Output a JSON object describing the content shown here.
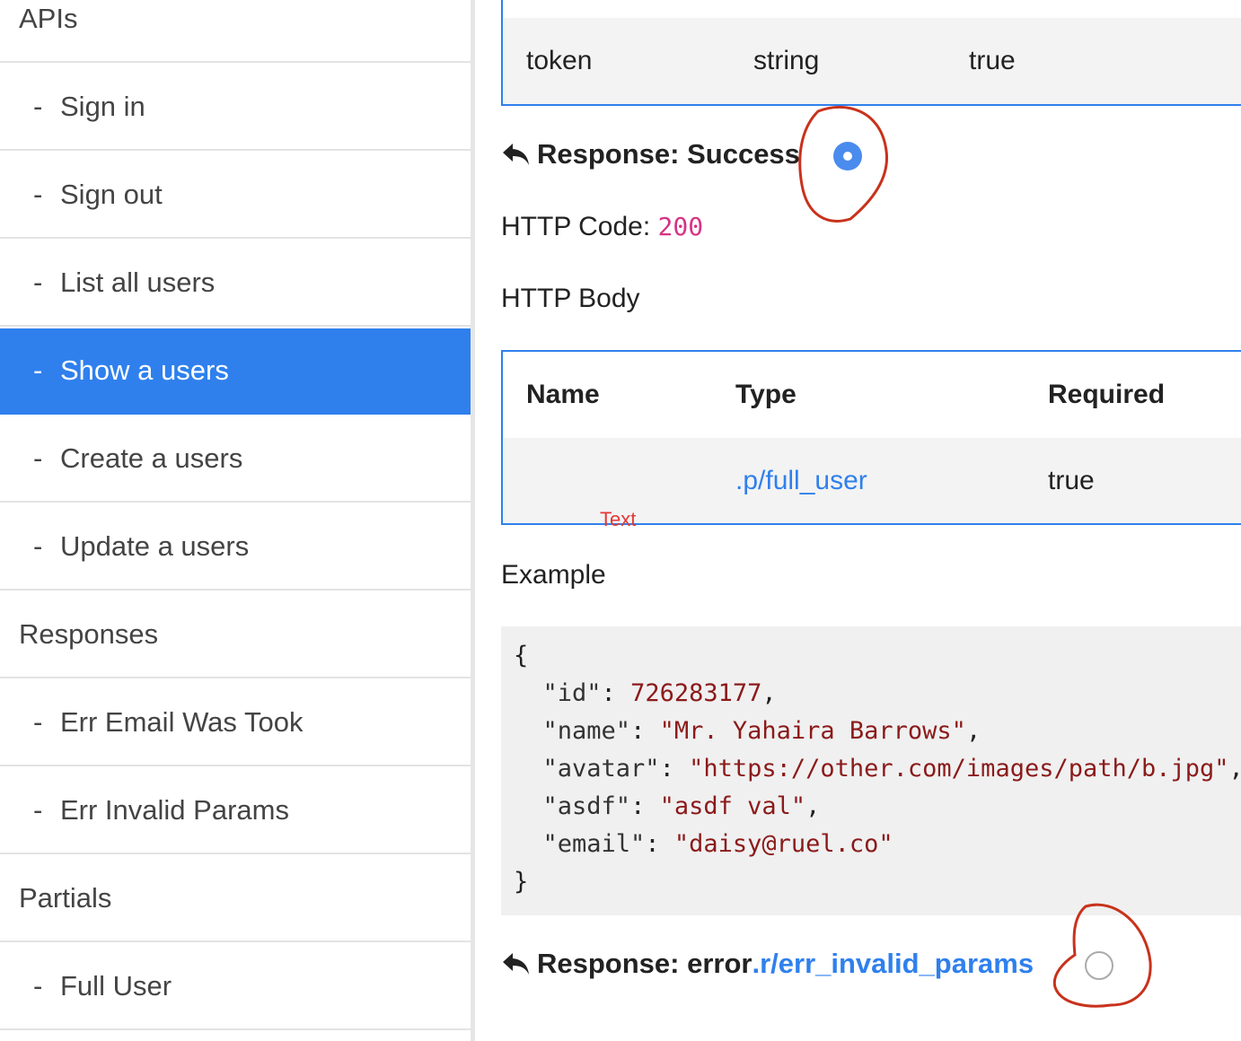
{
  "sidebar": {
    "sections": [
      {
        "label": "APIs",
        "items": [
          "Sign in",
          "Sign out",
          "List all users",
          "Show a users",
          "Create a users",
          "Update a users"
        ]
      },
      {
        "label": "Responses",
        "items": [
          "Err Email Was Took",
          "Err Invalid Params"
        ]
      },
      {
        "label": "Partials",
        "items": [
          "Full User"
        ]
      }
    ],
    "item_prefix": "-",
    "active_item": "Show a users",
    "active_color": "#2f80ed"
  },
  "params_table": {
    "row": {
      "name": "token",
      "type": "string",
      "required": "true"
    }
  },
  "response_success": {
    "label": "Response: Success",
    "icon": "reply-icon",
    "radio_selected": true,
    "http_code_label": "HTTP Code: ",
    "http_code": "200",
    "body_label": "HTTP Body",
    "table": {
      "headers": {
        "name": "Name",
        "type": "Type",
        "required": "Required"
      },
      "row": {
        "name": "",
        "type": ".p/full_user",
        "required": "true"
      }
    },
    "annotation_text": "Text",
    "example_label": "Example",
    "example": {
      "open": "{",
      "close": "}",
      "lines": [
        {
          "key": "\"id\"",
          "value": "726283177",
          "suffix": ","
        },
        {
          "key": "\"name\"",
          "value": "\"Mr. Yahaira Barrows\"",
          "suffix": ","
        },
        {
          "key": "\"avatar\"",
          "value": "\"https://other.com/images/path/b.jpg\"",
          "suffix": ","
        },
        {
          "key": "\"asdf\"",
          "value": "\"asdf val\"",
          "suffix": ","
        },
        {
          "key": "\"email\"",
          "value": "\"daisy@ruel.co\"",
          "suffix": ""
        }
      ]
    }
  },
  "response_error": {
    "label": "Response: error ",
    "link": ".r/err_invalid_params",
    "icon": "reply-icon",
    "radio_selected": false
  },
  "colors": {
    "accent": "#2f80ed",
    "http_code": "#d63384",
    "annotation": "#d23a1f"
  }
}
